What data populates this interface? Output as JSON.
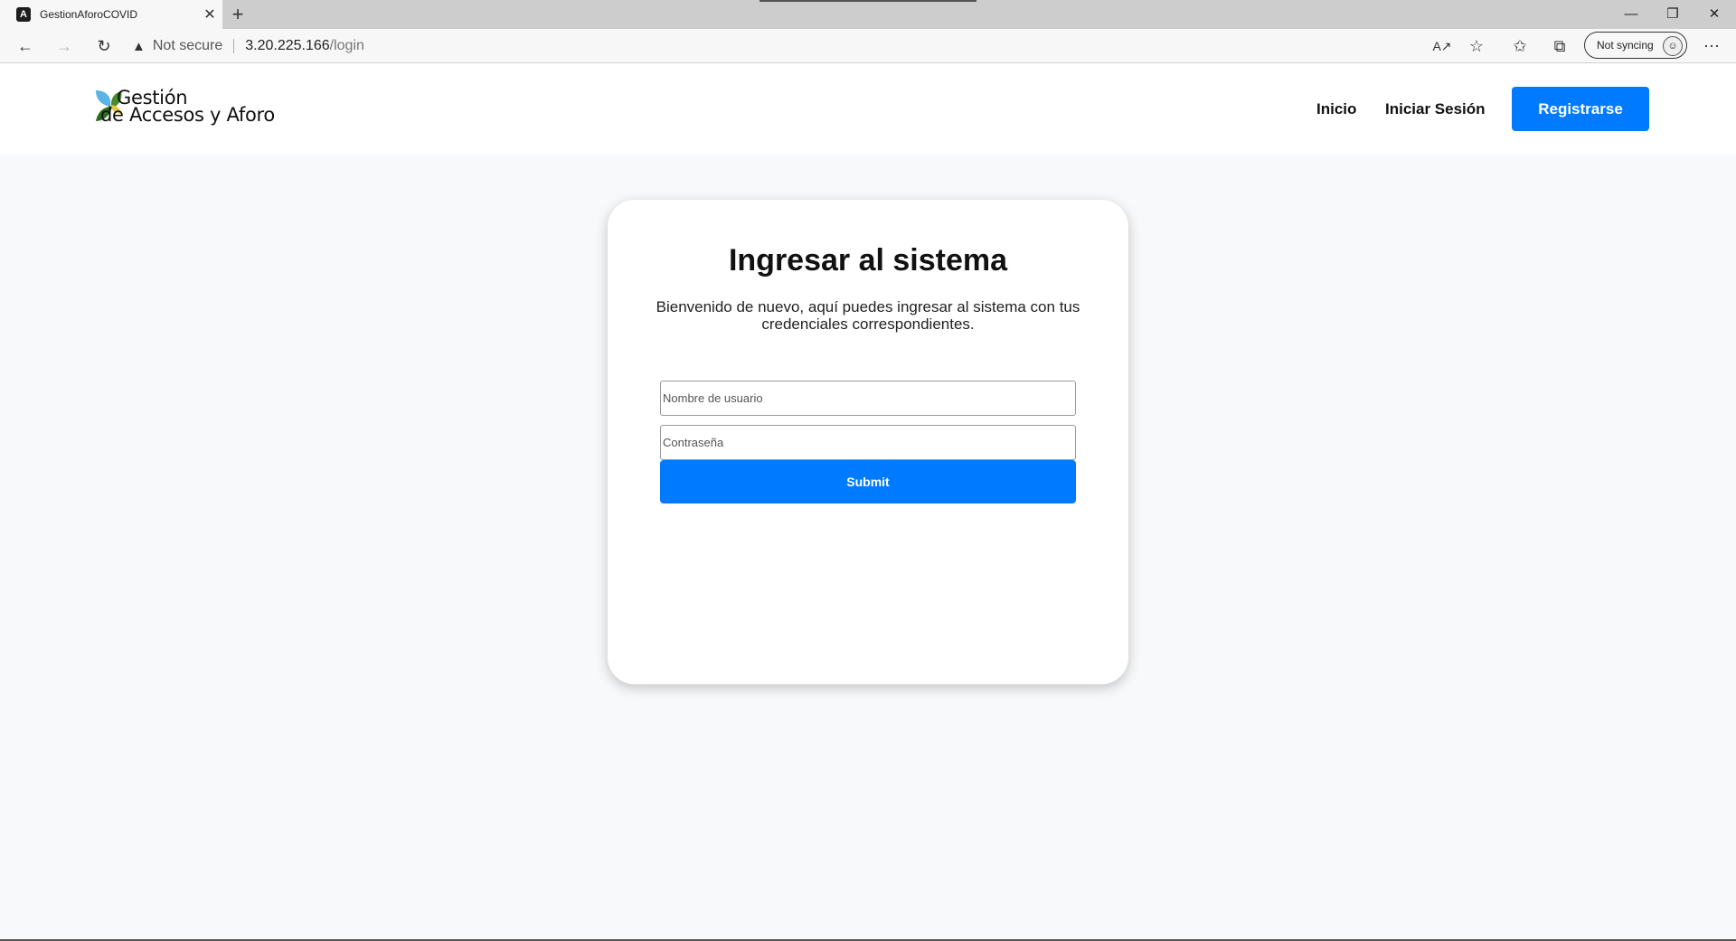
{
  "browser": {
    "tab_title": "GestionAforoCOVID",
    "tab_favicon": "A",
    "new_tab": "+",
    "security_text": "Not secure",
    "url_host": "3.20.225.166",
    "url_path": "/login",
    "profile_label": "Not syncing",
    "icons": [
      "back-arrow",
      "forward-arrow",
      "refresh",
      "warning",
      "read-aloud",
      "favorite-star",
      "favorites",
      "collections",
      "more"
    ]
  },
  "navbar": {
    "brand_line1": "Gestión",
    "brand_line2": "de Accesos y Aforo",
    "links": [
      "Inicio",
      "Iniciar Sesión"
    ],
    "register": "Registrarse"
  },
  "login": {
    "title": "Ingresar al sistema",
    "subtitle": "Bienvenido de nuevo, aquí puedes ingresar al sistema con tus credenciales correspondientes.",
    "username_placeholder": "Nombre de usuario",
    "password_placeholder": "Contraseña",
    "submit": "Submit"
  },
  "colors": {
    "primary": "#007bff",
    "page_bg": "#f8f9fa",
    "leaf_blue": "#5ab4e5",
    "leaf_green": "#4a8a2a",
    "leaf_yellow": "#e8c64a"
  }
}
